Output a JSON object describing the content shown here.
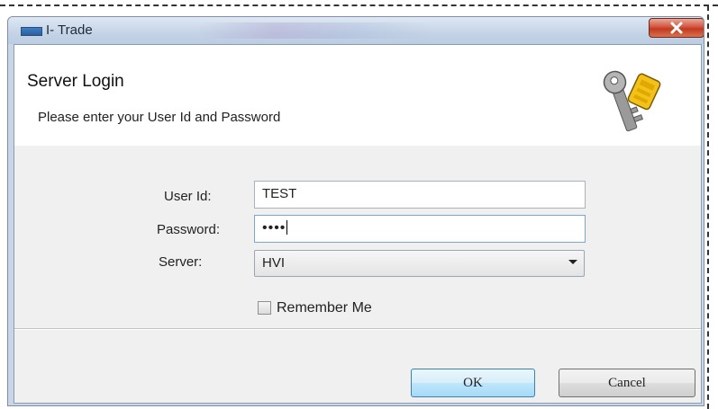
{
  "window": {
    "title": "I- Trade",
    "close_label": "x"
  },
  "header": {
    "title": "Server Login",
    "subtitle": "Please enter your User Id and Password",
    "icon": "keys-icon"
  },
  "form": {
    "user_id": {
      "label": "User Id:",
      "value": "TEST"
    },
    "password": {
      "label": "Password:",
      "masked_value": "••••"
    },
    "server": {
      "label": "Server:",
      "selected": "HVI"
    },
    "remember_me": {
      "label": "Remember Me",
      "checked": false
    }
  },
  "buttons": {
    "ok_label": "OK",
    "cancel_label": "Cancel"
  },
  "colors": {
    "close_button": "#c23a20",
    "ok_border": "#3c7fb1",
    "title_bar": "#c4d3e6"
  }
}
